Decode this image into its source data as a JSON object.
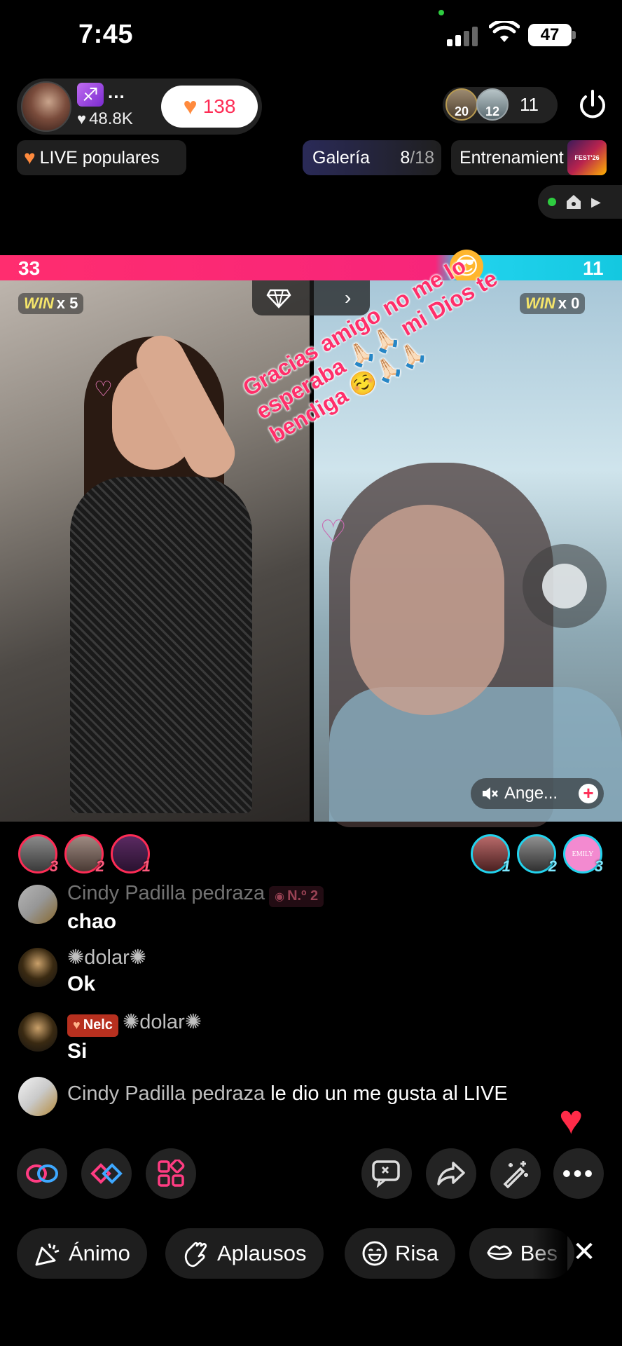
{
  "status_bar": {
    "time": "7:45",
    "battery": "47"
  },
  "host": {
    "badge_icon": "sagittarius-icon",
    "name": "...",
    "likes": "48.8K",
    "follow_count": "138"
  },
  "viewers": {
    "avatars": [
      "20",
      "12"
    ],
    "count": "11"
  },
  "chips": {
    "live_popular": "LIVE populares",
    "gallery_label": "Galería",
    "gallery_progress_current": "8",
    "gallery_progress_total": "/18",
    "training": "Entrenamient",
    "fest_label": "FEST'26 LIVE"
  },
  "battle": {
    "score_left": "33",
    "score_right": "11",
    "left_win_label": "WIN",
    "left_win_count": "x 5",
    "right_win_label": "WIN",
    "right_win_count": "x 0"
  },
  "overlay_message": "Gracias amigo no me lo esperaba 🙏🏻🙏🏻 mi Dios te bendiga ☺️🙏🏻🙏🏻",
  "guest": {
    "name": "Ange..."
  },
  "rankings": {
    "left": [
      "3",
      "2",
      "1"
    ],
    "right": [
      "1",
      "2",
      "3"
    ],
    "right_third_text": "EMILY"
  },
  "chat": [
    {
      "name": "Cindy Padilla pedraza",
      "badge": "N.º 2",
      "text": "chao"
    },
    {
      "name": "✺dolar✺",
      "text": "Ok"
    },
    {
      "badge": "Nelc",
      "name": "✺dolar✺",
      "text": "Si"
    },
    {
      "name": "Cindy Padilla pedraza",
      "text": "le dio un me gusta al LIVE"
    }
  ],
  "reactions": [
    "Ánimo",
    "Aplausos",
    "Risa",
    "Bes"
  ],
  "colors": {
    "accent": "#fe2c55",
    "battle_left": "#ff2d6f",
    "battle_right": "#22d3ee"
  }
}
